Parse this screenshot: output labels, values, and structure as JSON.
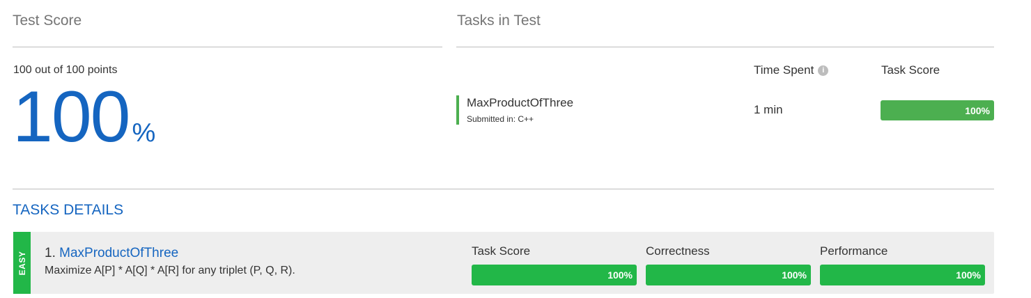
{
  "summary": {
    "title": "Test Score",
    "points_text": "100 out of 100 points",
    "score_value": "100",
    "score_unit": "%"
  },
  "tasks_in_test": {
    "title": "Tasks in Test",
    "time_header": "Time Spent",
    "info_icon": "info-icon",
    "score_header": "Task Score",
    "tasks": [
      {
        "name": "MaxProductOfThree",
        "submitted": "Submitted in: C++",
        "time": "1 min",
        "score_label": "100%",
        "score_fraction": 1.0
      }
    ]
  },
  "details": {
    "title": "TASKS DETAILS",
    "tasks": [
      {
        "difficulty": "EASY",
        "number": "1.",
        "name": "MaxProductOfThree",
        "description": "Maximize A[P] * A[Q] * A[R] for any triplet (P, Q, R).",
        "metrics": [
          {
            "label": "Task Score",
            "value": "100%",
            "fraction": 1.0
          },
          {
            "label": "Correctness",
            "value": "100%",
            "fraction": 1.0
          },
          {
            "label": "Performance",
            "value": "100%",
            "fraction": 1.0
          }
        ]
      }
    ]
  },
  "colors": {
    "accent_blue": "#1565c0",
    "score_green": "#4caf50",
    "detail_green": "#22b748",
    "card_bg": "#eeeeee"
  }
}
